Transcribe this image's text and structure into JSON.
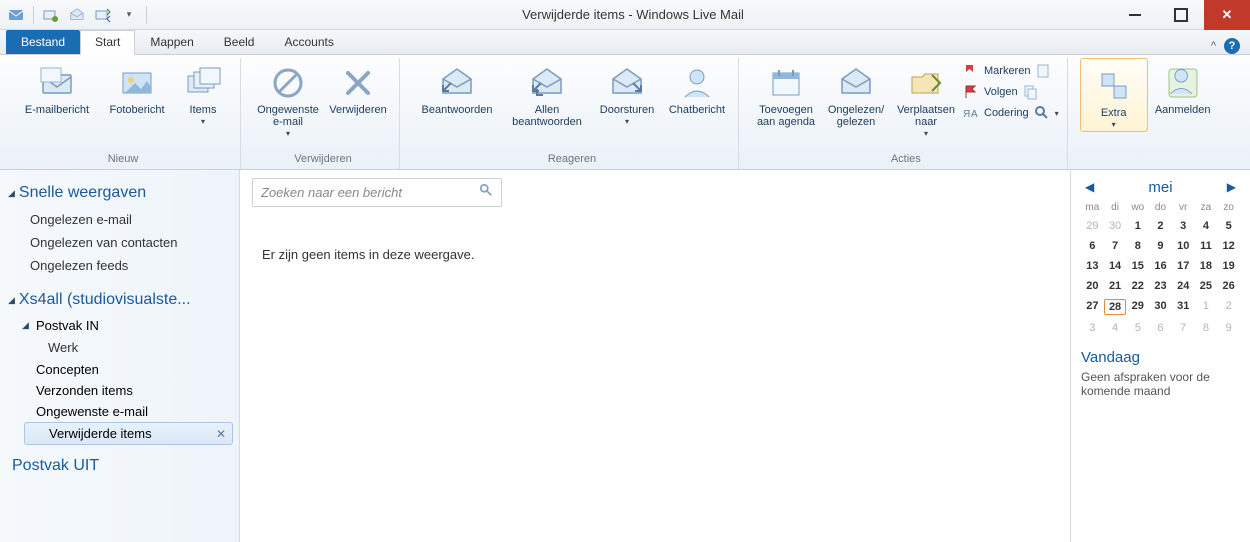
{
  "title": "Verwijderde items - Windows Live Mail",
  "tabs": {
    "file": "Bestand",
    "home": "Start",
    "folders": "Mappen",
    "view": "Beeld",
    "accounts": "Accounts"
  },
  "ribbon": {
    "new_group": "Nieuw",
    "email_msg": "E-mailbericht",
    "photo_msg": "Fotobericht",
    "items": "Items",
    "delete_group": "Verwijderen",
    "junk": "Ongewenste e-mail",
    "delete": "Verwijderen",
    "respond_group": "Reageren",
    "reply": "Beantwoorden",
    "reply_all": "Allen beantwoorden",
    "forward": "Doorsturen",
    "chat_msg": "Chatbericht",
    "actions_group": "Acties",
    "add_calendar": "Toevoegen aan agenda",
    "read_unread": "Ongelezen/ gelezen",
    "move_to": "Verplaatsen naar",
    "mark": "Markeren",
    "follow": "Volgen",
    "encoding": "Codering",
    "extra": "Extra",
    "signin": "Aanmelden"
  },
  "nav": {
    "quick_views": "Snelle weergaven",
    "unread_mail": "Ongelezen e-mail",
    "unread_contacts": "Ongelezen van contacten",
    "unread_feeds": "Ongelezen feeds",
    "account": "Xs4all (studiovisualste...",
    "inbox": "Postvak IN",
    "work": "Werk",
    "drafts": "Concepten",
    "sent": "Verzonden items",
    "junk": "Ongewenste e-mail",
    "deleted": "Verwijderde items",
    "outbox": "Postvak UIT"
  },
  "search": {
    "placeholder": "Zoeken naar een bericht"
  },
  "empty": "Er zijn geen items in deze weergave.",
  "calendar": {
    "month": "mei",
    "dow": [
      "ma",
      "di",
      "wo",
      "do",
      "vr",
      "za",
      "zo"
    ],
    "weeks": [
      [
        {
          "d": 29,
          "o": true
        },
        {
          "d": 30,
          "o": true
        },
        {
          "d": 1,
          "b": true
        },
        {
          "d": 2,
          "b": true
        },
        {
          "d": 3,
          "b": true
        },
        {
          "d": 4,
          "b": true
        },
        {
          "d": 5,
          "b": true
        }
      ],
      [
        {
          "d": 6,
          "b": true
        },
        {
          "d": 7,
          "b": true
        },
        {
          "d": 8,
          "b": true
        },
        {
          "d": 9,
          "b": true
        },
        {
          "d": 10,
          "b": true
        },
        {
          "d": 11,
          "b": true
        },
        {
          "d": 12,
          "b": true
        }
      ],
      [
        {
          "d": 13,
          "b": true
        },
        {
          "d": 14,
          "b": true
        },
        {
          "d": 15,
          "b": true
        },
        {
          "d": 16,
          "b": true
        },
        {
          "d": 17,
          "b": true
        },
        {
          "d": 18,
          "b": true
        },
        {
          "d": 19,
          "b": true
        }
      ],
      [
        {
          "d": 20,
          "b": true
        },
        {
          "d": 21,
          "b": true
        },
        {
          "d": 22,
          "b": true
        },
        {
          "d": 23,
          "b": true
        },
        {
          "d": 24,
          "b": true
        },
        {
          "d": 25,
          "b": true
        },
        {
          "d": 26,
          "b": true
        }
      ],
      [
        {
          "d": 27,
          "b": true
        },
        {
          "d": 28,
          "b": true,
          "t": true
        },
        {
          "d": 29,
          "b": true
        },
        {
          "d": 30,
          "b": true
        },
        {
          "d": 31,
          "b": true
        },
        {
          "d": 1,
          "o": true
        },
        {
          "d": 2,
          "o": true
        }
      ],
      [
        {
          "d": 3,
          "o": true
        },
        {
          "d": 4,
          "o": true
        },
        {
          "d": 5,
          "o": true
        },
        {
          "d": 6,
          "o": true
        },
        {
          "d": 7,
          "o": true
        },
        {
          "d": 8,
          "o": true
        },
        {
          "d": 9,
          "o": true
        }
      ]
    ],
    "today_head": "Vandaag",
    "today_text": "Geen afspraken voor de komende maand"
  }
}
